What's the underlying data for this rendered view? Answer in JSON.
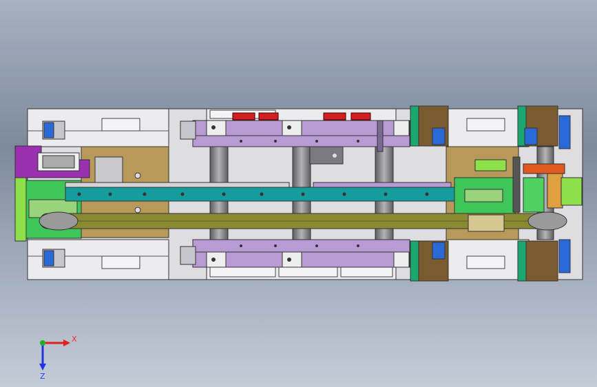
{
  "app": {
    "view_name": "cad-3d-viewport",
    "model_description_hidden": ""
  },
  "triad": {
    "x_label": "X",
    "z_label": "Z",
    "x_color": "#e02020",
    "z_color": "#2035e0",
    "origin_color": "#20b020"
  },
  "colors": {
    "frame_light": "#e9e9ec",
    "frame_mid": "#c9c9cf",
    "frame_dark": "#5a5a60",
    "purple_plate": "#b89bd4",
    "teal_rail": "#159c9c",
    "olive_belt": "#8a8a32",
    "green_block": "#3fc65a",
    "lime_motor": "#8ee04a",
    "tan_mount": "#b79a5a",
    "blue_block": "#2a6ad8",
    "brown_block": "#7a5a30",
    "red_pad": "#d02020",
    "magenta_part": "#9a2fb0",
    "grey_shaft": "#8a8a8a"
  }
}
